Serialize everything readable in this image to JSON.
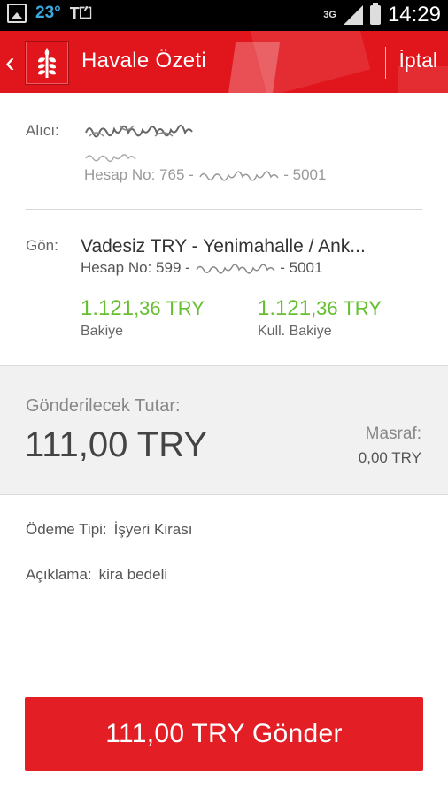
{
  "status_bar": {
    "temperature": "23°",
    "network": "3G",
    "time": "14:29"
  },
  "app_bar": {
    "title": "Havale Özeti",
    "cancel_label": "İptal"
  },
  "recipient": {
    "label": "Alıcı:",
    "account_prefix": "Hesap No: 765 - ",
    "account_suffix": " - 5001"
  },
  "sender": {
    "label": "Gön:",
    "account_title": "Vadesiz TRY - Yenimahalle / Ank...",
    "account_prefix": "Hesap No: 599 - ",
    "account_suffix": " - 5001",
    "balance_int": "1.121",
    "balance_dec": ",36 TRY",
    "balance_label": "Bakiye",
    "usable_int": "1.121",
    "usable_dec": ",36 TRY",
    "usable_label": "Kull. Bakiye"
  },
  "amount": {
    "label": "Gönderilecek Tutar:",
    "value": "111,00 TRY",
    "fee_label": "Masraf:",
    "fee_value": "0,00 TRY"
  },
  "details": {
    "payment_type_label": "Ödeme Tipi:",
    "payment_type_value": "İşyeri Kirası",
    "description_label": "Açıklama:",
    "description_value": "kira bedeli"
  },
  "action": {
    "send_label": "111,00 TRY Gönder"
  },
  "colors": {
    "brand": "#e0161c",
    "balance_green": "#66bf2f"
  }
}
